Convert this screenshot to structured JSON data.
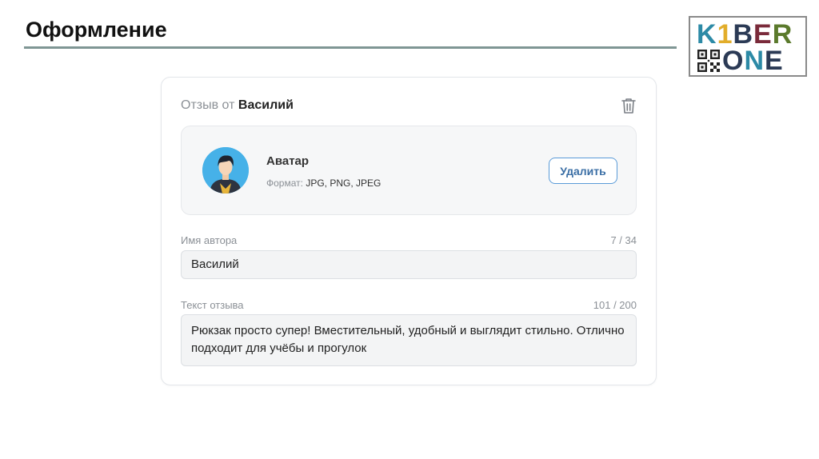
{
  "slide": {
    "title": "Оформление"
  },
  "logo": {
    "row1": [
      "K",
      "1",
      "B",
      "E",
      "R"
    ],
    "row2": [
      "O",
      "N",
      "E"
    ]
  },
  "review": {
    "header_prefix": "Отзыв от",
    "author": "Василий",
    "trash_icon": "trash-icon",
    "avatar": {
      "title": "Аватар",
      "format_label": "Формат:",
      "format_value": "JPG, PNG, JPEG",
      "delete_label": "Удалить"
    },
    "author_field": {
      "label": "Имя автора",
      "counter": "7 / 34",
      "value": "Василий"
    },
    "text_field": {
      "label": "Текст отзыва",
      "counter": "101 / 200",
      "value": "Рюкзак просто супер! Вместительный, удобный и выглядит стильно. Отлично подходит для учёбы и прогулок"
    }
  },
  "colors": {
    "rule": "#7f9694",
    "button_border": "#5a9bd8",
    "avatar_bg": "#46b1e8"
  }
}
